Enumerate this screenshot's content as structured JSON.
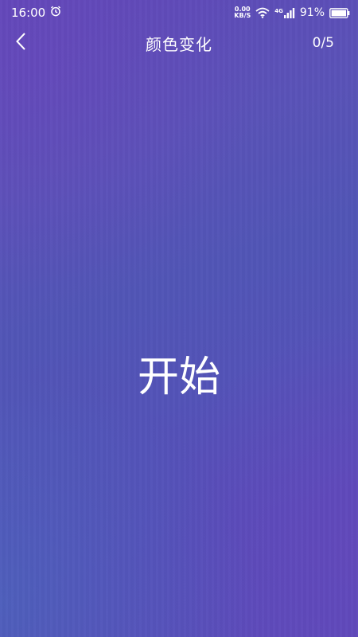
{
  "status_bar": {
    "time": "16:00",
    "net_speed_value": "0.00",
    "net_speed_unit": "KB/S",
    "network_type": "4G",
    "battery_percent": "91%",
    "icons": [
      "alarm-clock-icon",
      "wifi-icon",
      "cellular-signal-icon",
      "battery-icon"
    ]
  },
  "header": {
    "back_icon": "chevron-left-icon",
    "title": "颜色变化",
    "progress": "0/5"
  },
  "main": {
    "start_label": "开始"
  },
  "colors": {
    "background_primary": "#5a4fb4",
    "background_purple": "#5f48b8",
    "background_blue": "#466ebe",
    "text": "#ffffff"
  }
}
